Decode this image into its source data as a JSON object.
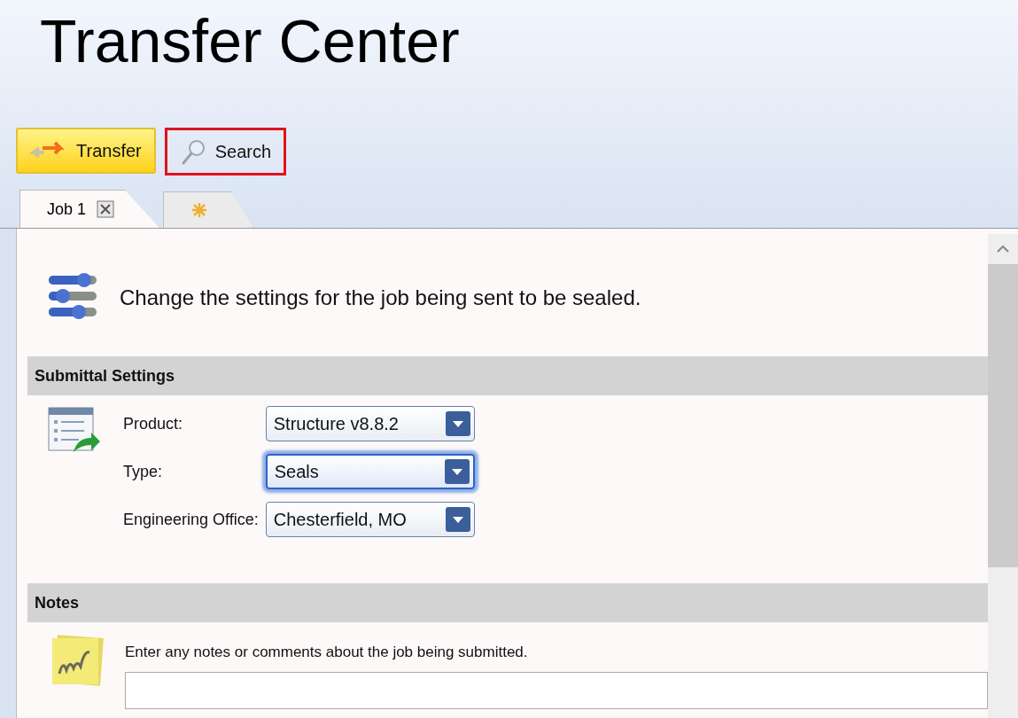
{
  "title": "Transfer Center",
  "toolbar": [
    {
      "kind": "transfer",
      "label": "Transfer",
      "selected": true,
      "highlighted": false
    },
    {
      "kind": "search",
      "label": "Search",
      "selected": false,
      "highlighted": true
    }
  ],
  "tabs": [
    {
      "kind": "job",
      "label": "Job 1",
      "selected": true
    },
    {
      "kind": "new",
      "selected": false
    }
  ],
  "intro": "Change the settings for the job being sent to be sealed.",
  "sections": [
    {
      "kind": "settings",
      "title": "Submittal Settings",
      "fields": [
        {
          "label": "Product:",
          "value": "Structure v8.8.2",
          "focused": false
        },
        {
          "label": "Type:",
          "value": "Seals",
          "focused": true
        },
        {
          "label": "Engineering Office:",
          "value": "Chesterfield, MO",
          "focused": false
        }
      ]
    },
    {
      "kind": "notes",
      "title": "Notes",
      "prompt": "Enter any notes or comments about the job being submitted."
    }
  ]
}
